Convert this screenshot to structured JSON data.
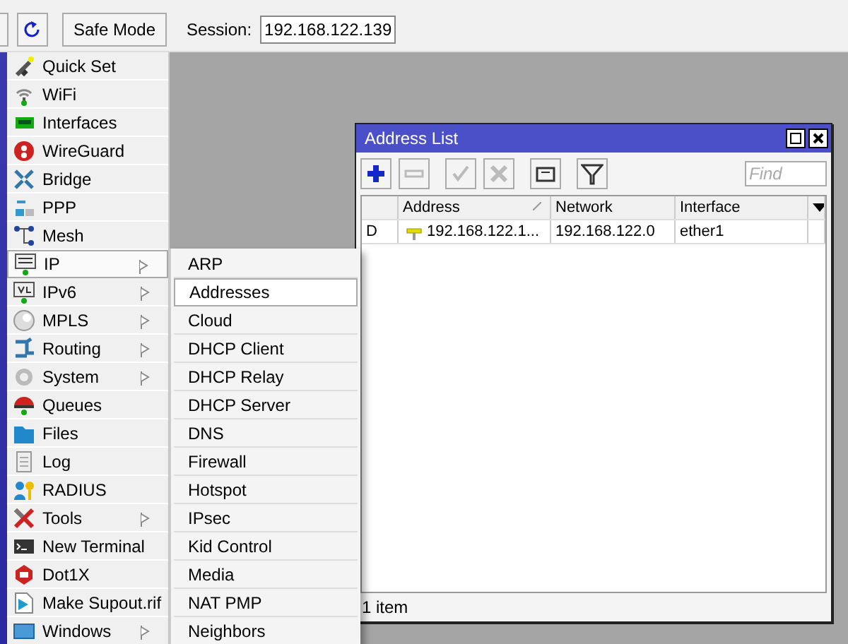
{
  "toolbar": {
    "safe_mode": "Safe Mode",
    "session_label": "Session:",
    "session_value": "192.168.122.139"
  },
  "sidebar": {
    "items": [
      {
        "label": "Quick Set",
        "submenu": false,
        "selected": false
      },
      {
        "label": "WiFi",
        "submenu": false,
        "selected": false
      },
      {
        "label": "Interfaces",
        "submenu": false,
        "selected": false
      },
      {
        "label": "WireGuard",
        "submenu": false,
        "selected": false
      },
      {
        "label": "Bridge",
        "submenu": false,
        "selected": false
      },
      {
        "label": "PPP",
        "submenu": false,
        "selected": false
      },
      {
        "label": "Mesh",
        "submenu": false,
        "selected": false
      },
      {
        "label": "IP",
        "submenu": true,
        "selected": true
      },
      {
        "label": "IPv6",
        "submenu": true,
        "selected": false
      },
      {
        "label": "MPLS",
        "submenu": true,
        "selected": false
      },
      {
        "label": "Routing",
        "submenu": true,
        "selected": false
      },
      {
        "label": "System",
        "submenu": true,
        "selected": false
      },
      {
        "label": "Queues",
        "submenu": false,
        "selected": false
      },
      {
        "label": "Files",
        "submenu": false,
        "selected": false
      },
      {
        "label": "Log",
        "submenu": false,
        "selected": false
      },
      {
        "label": "RADIUS",
        "submenu": false,
        "selected": false
      },
      {
        "label": "Tools",
        "submenu": true,
        "selected": false
      },
      {
        "label": "New Terminal",
        "submenu": false,
        "selected": false
      },
      {
        "label": "Dot1X",
        "submenu": false,
        "selected": false
      },
      {
        "label": "Make Supout.rif",
        "submenu": false,
        "selected": false
      },
      {
        "label": "Windows",
        "submenu": true,
        "selected": false
      }
    ]
  },
  "submenu": {
    "items": [
      {
        "label": "ARP",
        "selected": false
      },
      {
        "label": "Addresses",
        "selected": true
      },
      {
        "label": "Cloud",
        "selected": false
      },
      {
        "label": "DHCP Client",
        "selected": false
      },
      {
        "label": "DHCP Relay",
        "selected": false
      },
      {
        "label": "DHCP Server",
        "selected": false
      },
      {
        "label": "DNS",
        "selected": false
      },
      {
        "label": "Firewall",
        "selected": false
      },
      {
        "label": "Hotspot",
        "selected": false
      },
      {
        "label": "IPsec",
        "selected": false
      },
      {
        "label": "Kid Control",
        "selected": false
      },
      {
        "label": "Media",
        "selected": false
      },
      {
        "label": "NAT PMP",
        "selected": false
      },
      {
        "label": "Neighbors",
        "selected": false
      }
    ]
  },
  "window": {
    "title": "Address List",
    "tools": [
      {
        "kind": "add",
        "disabled": false
      },
      {
        "kind": "remove",
        "disabled": true
      },
      {
        "kind": "enable",
        "disabled": true
      },
      {
        "kind": "disable",
        "disabled": true
      },
      {
        "kind": "comment",
        "disabled": false
      },
      {
        "kind": "filter",
        "disabled": false
      }
    ],
    "find": {
      "placeholder": "Find"
    },
    "columns": [
      {
        "sorted": false
      },
      {
        "label": "Address",
        "sorted": true
      },
      {
        "label": "Network",
        "sorted": false
      },
      {
        "label": "Interface",
        "sorted": false
      }
    ],
    "rows": [
      {
        "flag": "D",
        "address": "192.168.122.1...",
        "network": "192.168.122.0",
        "interface": "ether1"
      }
    ],
    "status": "1 item"
  }
}
